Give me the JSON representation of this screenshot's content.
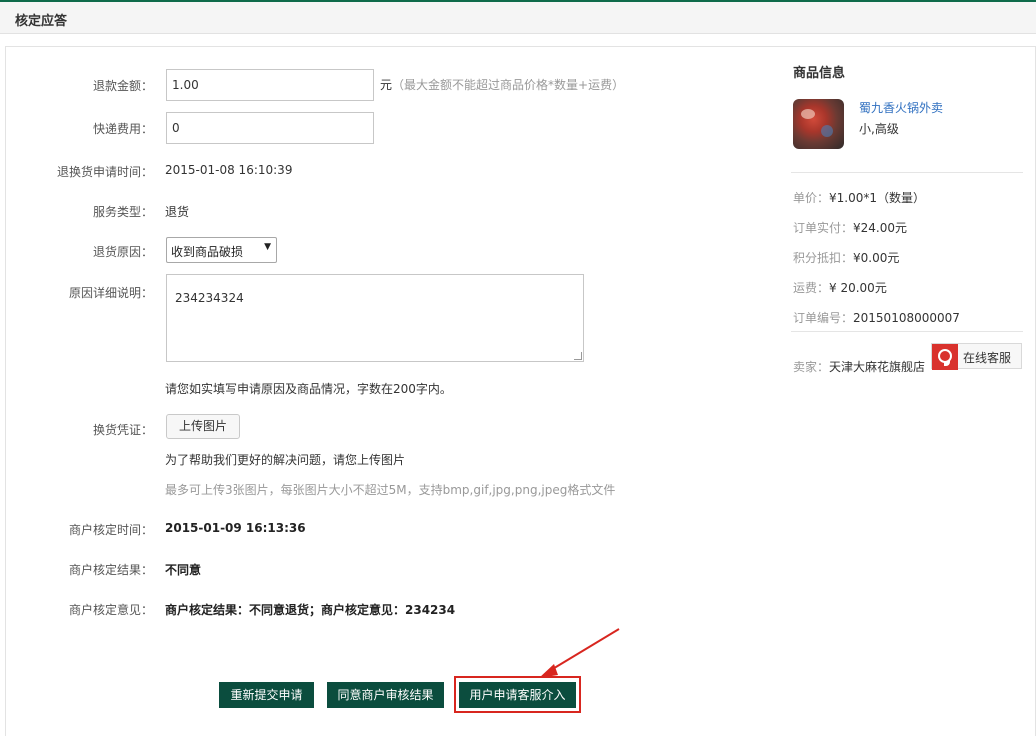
{
  "header": {
    "title": "核定应答"
  },
  "form": {
    "refund_amount_label": "退款金额：",
    "refund_amount_value": "1.00",
    "refund_unit": "元",
    "refund_hint": "（最大金额不能超过商品价格*数量+运费）",
    "shipping_fee_label": "快递费用：",
    "shipping_fee_value": "0",
    "apply_time_label": "退换货申请时间：",
    "apply_time_value": "2015-01-08 16:10:39",
    "service_type_label": "服务类型：",
    "service_type_value": "退货",
    "reason_label": "退货原因：",
    "reason_value": "收到商品破损",
    "detail_label": "原因详细说明：",
    "detail_value": "234234324",
    "detail_tip": "请您如实填写申请原因及商品情况，字数在200字内。",
    "voucher_label": "换货凭证：",
    "upload_button": "上传图片",
    "upload_tip": "为了帮助我们更好的解决问题，请您上传图片",
    "upload_limit": "最多可上传3张图片，每张图片大小不超过5M，支持bmp,gif,jpg,png,jpeg格式文件",
    "merchant_time_label": "商户核定时间：",
    "merchant_time_value": "2015-01-09 16:13:36",
    "merchant_result_label": "商户核定结果：",
    "merchant_result_value": "不同意",
    "merchant_opinion_label": "商户核定意见：",
    "merchant_opinion_value": "商户核定结果：不同意退货；商户核定意见：234234"
  },
  "actions": {
    "resubmit": "重新提交申请",
    "agree": "同意商户审核结果",
    "escalate": "用户申请客服介入"
  },
  "sidebar": {
    "title": "商品信息",
    "product_name": "蜀九香火锅外卖",
    "product_spec": "小,高级",
    "unit_price_label": "单价：",
    "unit_price_value": "¥1.00*1（数量）",
    "paid_label": "订单实付：",
    "paid_value": "¥24.00元",
    "points_label": "积分抵扣：",
    "points_value": "¥0.00元",
    "freight_label": "运费：",
    "freight_value": "¥ 20.00元",
    "order_no_label": "订单编号：",
    "order_no_value": "20150108000007",
    "seller_label": "卖家：",
    "seller_value": "天津大麻花旗舰店",
    "online_service": "在线客服"
  },
  "colors": {
    "accent": "#0f6b4b",
    "button_bg": "#0b4d3e",
    "highlight": "#d8261f",
    "link": "#3070c0"
  }
}
